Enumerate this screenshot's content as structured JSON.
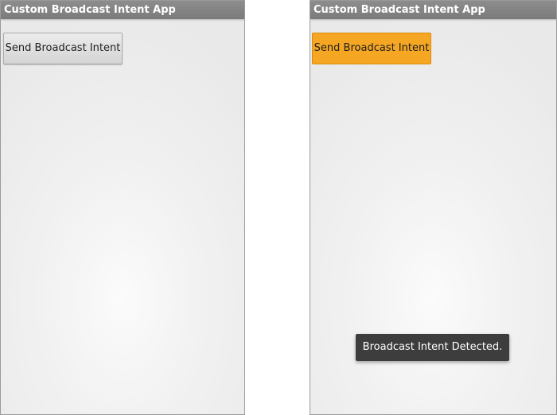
{
  "left_screen": {
    "app_title": "Custom Broadcast Intent App",
    "send_button_label": "Send Broadcast Intent"
  },
  "right_screen": {
    "app_title": "Custom Broadcast Intent App",
    "send_button_label": "Send Broadcast Intent",
    "toast_message": "Broadcast Intent Detected."
  },
  "colors": {
    "title_bar": "#808080",
    "pressed_button": "#f5a623",
    "toast_background": "#3d3d3d"
  }
}
